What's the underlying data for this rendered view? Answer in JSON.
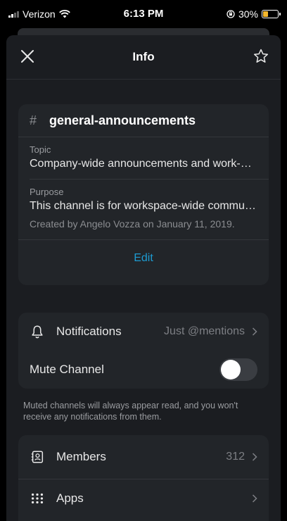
{
  "status_bar": {
    "carrier": "Verizon",
    "time": "6:13 PM",
    "battery": "30%"
  },
  "nav": {
    "title": "Info"
  },
  "channel": {
    "hash": "#",
    "name": "general-announcements",
    "topic_label": "Topic",
    "topic": "Company-wide announcements and work-…",
    "purpose_label": "Purpose",
    "purpose": "This channel is for workspace-wide commu…",
    "created": "Created by Angelo Vozza on January 11, 2019.",
    "edit_label": "Edit"
  },
  "settings": {
    "notifications_label": "Notifications",
    "notifications_value": "Just @mentions",
    "mute_label": "Mute Channel",
    "mute_on": false,
    "mute_hint": "Muted channels will always appear read, and you won't receive any notifications from them."
  },
  "sections": {
    "members_label": "Members",
    "members_count": "312",
    "apps_label": "Apps"
  },
  "colors": {
    "accent": "#1d9bd1",
    "battery": "#f5b82e",
    "background": "#1b1d21"
  }
}
